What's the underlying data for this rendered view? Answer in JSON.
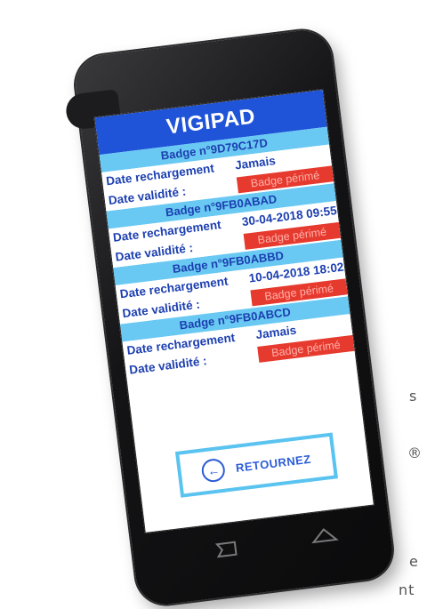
{
  "background_text": {
    "line1": "s",
    "line2": "®",
    "line3": "e",
    "line4": "nt"
  },
  "app": {
    "title": "VIGIPAD"
  },
  "labels": {
    "recharge": "Date rechargement",
    "validity": "Date validité :"
  },
  "badges": [
    {
      "header": "Badge n°9D79C17D",
      "recharge_value": "Jamais",
      "validity_value": "Badge périmé"
    },
    {
      "header": "Badge n°9FB0ABAD",
      "recharge_value": "30-04-2018 09:55",
      "validity_value": "Badge périmé"
    },
    {
      "header": "Badge n°9FB0ABBD",
      "recharge_value": "10-04-2018 18:02",
      "validity_value": "Badge périmé"
    },
    {
      "header": "Badge n°9FB0ABCD",
      "recharge_value": "Jamais",
      "validity_value": "Badge périmé"
    }
  ],
  "back_button": {
    "label": "RETOURNEZ",
    "icon": "arrow-left-circle-icon"
  },
  "colors": {
    "title_bar": "#1f53d8",
    "badge_header": "#69c9f3",
    "expired": "#e63a2f",
    "text": "#1c3fb0"
  }
}
